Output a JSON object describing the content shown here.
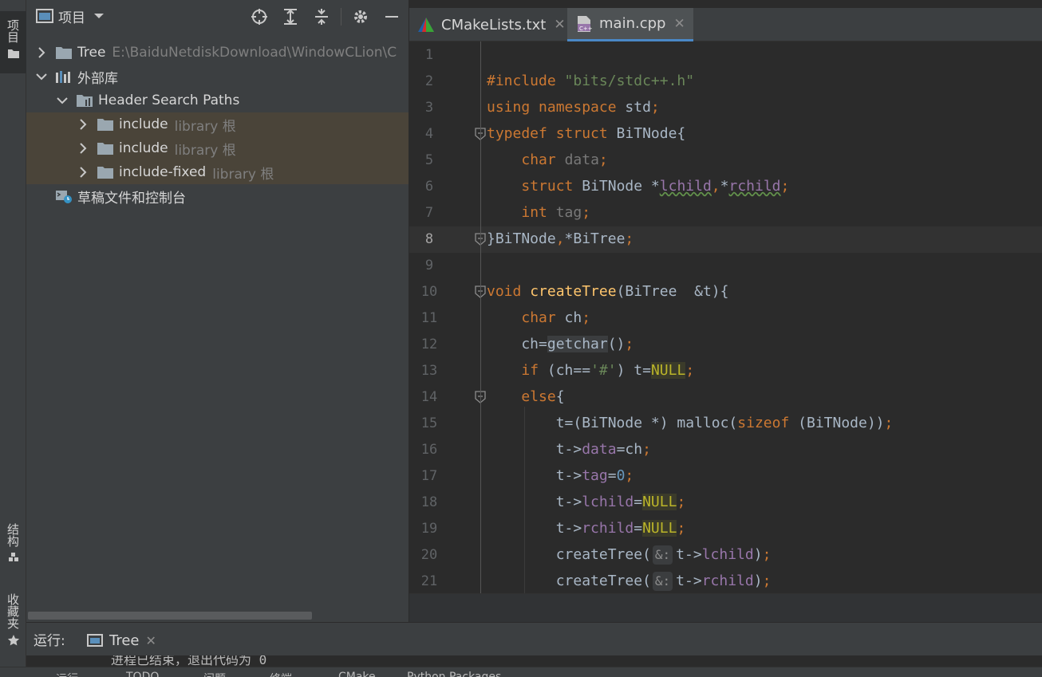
{
  "sidebar": {
    "project_label": "项目",
    "structure_label": "结构",
    "favorites_label": "收藏夹"
  },
  "project_panel": {
    "title": "项目",
    "tree": [
      {
        "label": "Tree",
        "hint": "E:\\BaiduNetdiskDownload\\WindowCLion\\C",
        "expanded": false
      },
      {
        "label": "外部库",
        "hint": "",
        "expanded": true
      },
      {
        "label": "Header Search Paths",
        "hint": "",
        "expanded": true
      },
      {
        "label": "include",
        "hint": "library 根",
        "expanded": false
      },
      {
        "label": "include",
        "hint": "library 根",
        "expanded": false
      },
      {
        "label": "include-fixed",
        "hint": "library 根",
        "expanded": false
      },
      {
        "label": "草稿文件和控制台",
        "hint": ""
      }
    ]
  },
  "editor": {
    "tabs": [
      {
        "label": "CMakeLists.txt",
        "active": false
      },
      {
        "label": "main.cpp",
        "active": true
      }
    ],
    "current_line": 8,
    "line_numbers": [
      "1",
      "2",
      "3",
      "4",
      "5",
      "6",
      "7",
      "8",
      "9",
      "10",
      "11",
      "12",
      "13",
      "14",
      "15",
      "16",
      "17",
      "18",
      "19",
      "20",
      "21"
    ],
    "code_lines": [
      "",
      "#include \"bits/stdc++.h\"",
      "using namespace std;",
      "typedef struct BiTNode{",
      "    char data;",
      "    struct BiTNode *lchild,*rchild;",
      "    int tag;",
      "}BiTNode,*BiTree;",
      "",
      "void createTree(BiTree  &t){",
      "    char ch;",
      "    ch=getchar();",
      "    if (ch=='#') t=NULL;",
      "    else{",
      "        t=(BiTNode *) malloc(sizeof (BiTNode));",
      "        t->data=ch;",
      "        t->tag=0;",
      "        t->lchild=NULL;",
      "        t->rchild=NULL;",
      "        createTree( &: t->lchild);",
      "        createTree( &: t->rchild);"
    ],
    "param_hint": "&:"
  },
  "run_panel": {
    "label": "运行:",
    "tab_label": "Tree",
    "console_text": "进程已结束，退出代码为 0"
  },
  "bottom_tools": [
    "运行",
    "TODO",
    "问题",
    "终端",
    "CMake",
    "Python Packages"
  ]
}
